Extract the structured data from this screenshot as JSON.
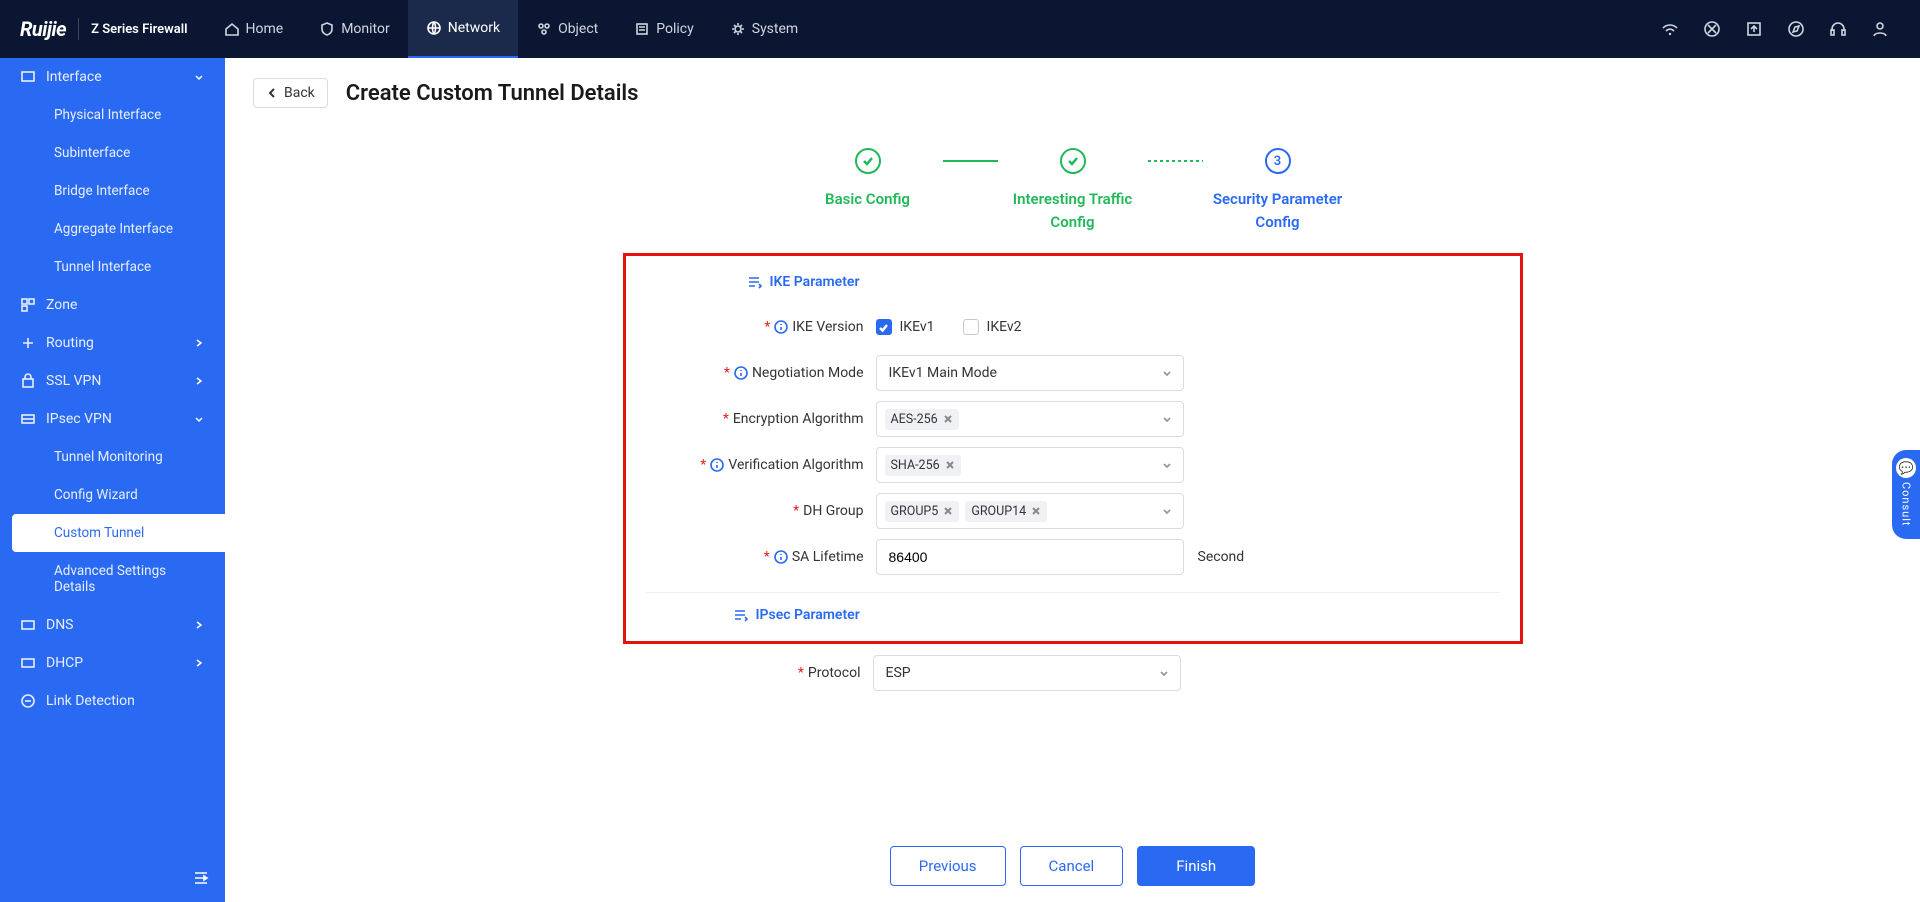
{
  "brand": {
    "logo": "Ruijie",
    "sub": "Z Series Firewall"
  },
  "topnav": {
    "home": "Home",
    "monitor": "Monitor",
    "network": "Network",
    "object": "Object",
    "policy": "Policy",
    "system": "System"
  },
  "sidebar": {
    "interface": "Interface",
    "physical": "Physical Interface",
    "subinterface": "Subinterface",
    "bridge": "Bridge Interface",
    "aggregate": "Aggregate Interface",
    "tunnel": "Tunnel Interface",
    "zone": "Zone",
    "routing": "Routing",
    "sslvpn": "SSL VPN",
    "ipsecvpn": "IPsec VPN",
    "tunnelmon": "Tunnel Monitoring",
    "configwiz": "Config Wizard",
    "custom": "Custom Tunnel",
    "advanced": "Advanced Settings Details",
    "dns": "DNS",
    "dhcp": "DHCP",
    "linkdet": "Link Detection"
  },
  "page": {
    "back": "Back",
    "title": "Create Custom Tunnel Details"
  },
  "steps": {
    "s1": "Basic Config",
    "s2": "Interesting Traffic Config",
    "s3": "Security Parameter Config",
    "n3": "3"
  },
  "form": {
    "ike_header": "IKE Parameter",
    "ipsec_header": "IPsec Parameter",
    "labels": {
      "ike_version": "IKE Version",
      "neg_mode": "Negotiation Mode",
      "enc_alg": "Encryption Algorithm",
      "ver_alg": "Verification Algorithm",
      "dh_group": "DH Group",
      "sa_life": "SA Lifetime",
      "protocol": "Protocol"
    },
    "ike_opts": {
      "v1": "IKEv1",
      "v2": "IKEv2"
    },
    "values": {
      "neg_mode": "IKEv1 Main Mode",
      "enc_tags": [
        "AES-256"
      ],
      "ver_tags": [
        "SHA-256"
      ],
      "dh_tags": [
        "GROUP5",
        "GROUP14"
      ],
      "sa_life": "86400",
      "sa_suffix": "Second",
      "protocol": "ESP"
    }
  },
  "footer": {
    "prev": "Previous",
    "cancel": "Cancel",
    "finish": "Finish"
  },
  "consult": "Consult"
}
